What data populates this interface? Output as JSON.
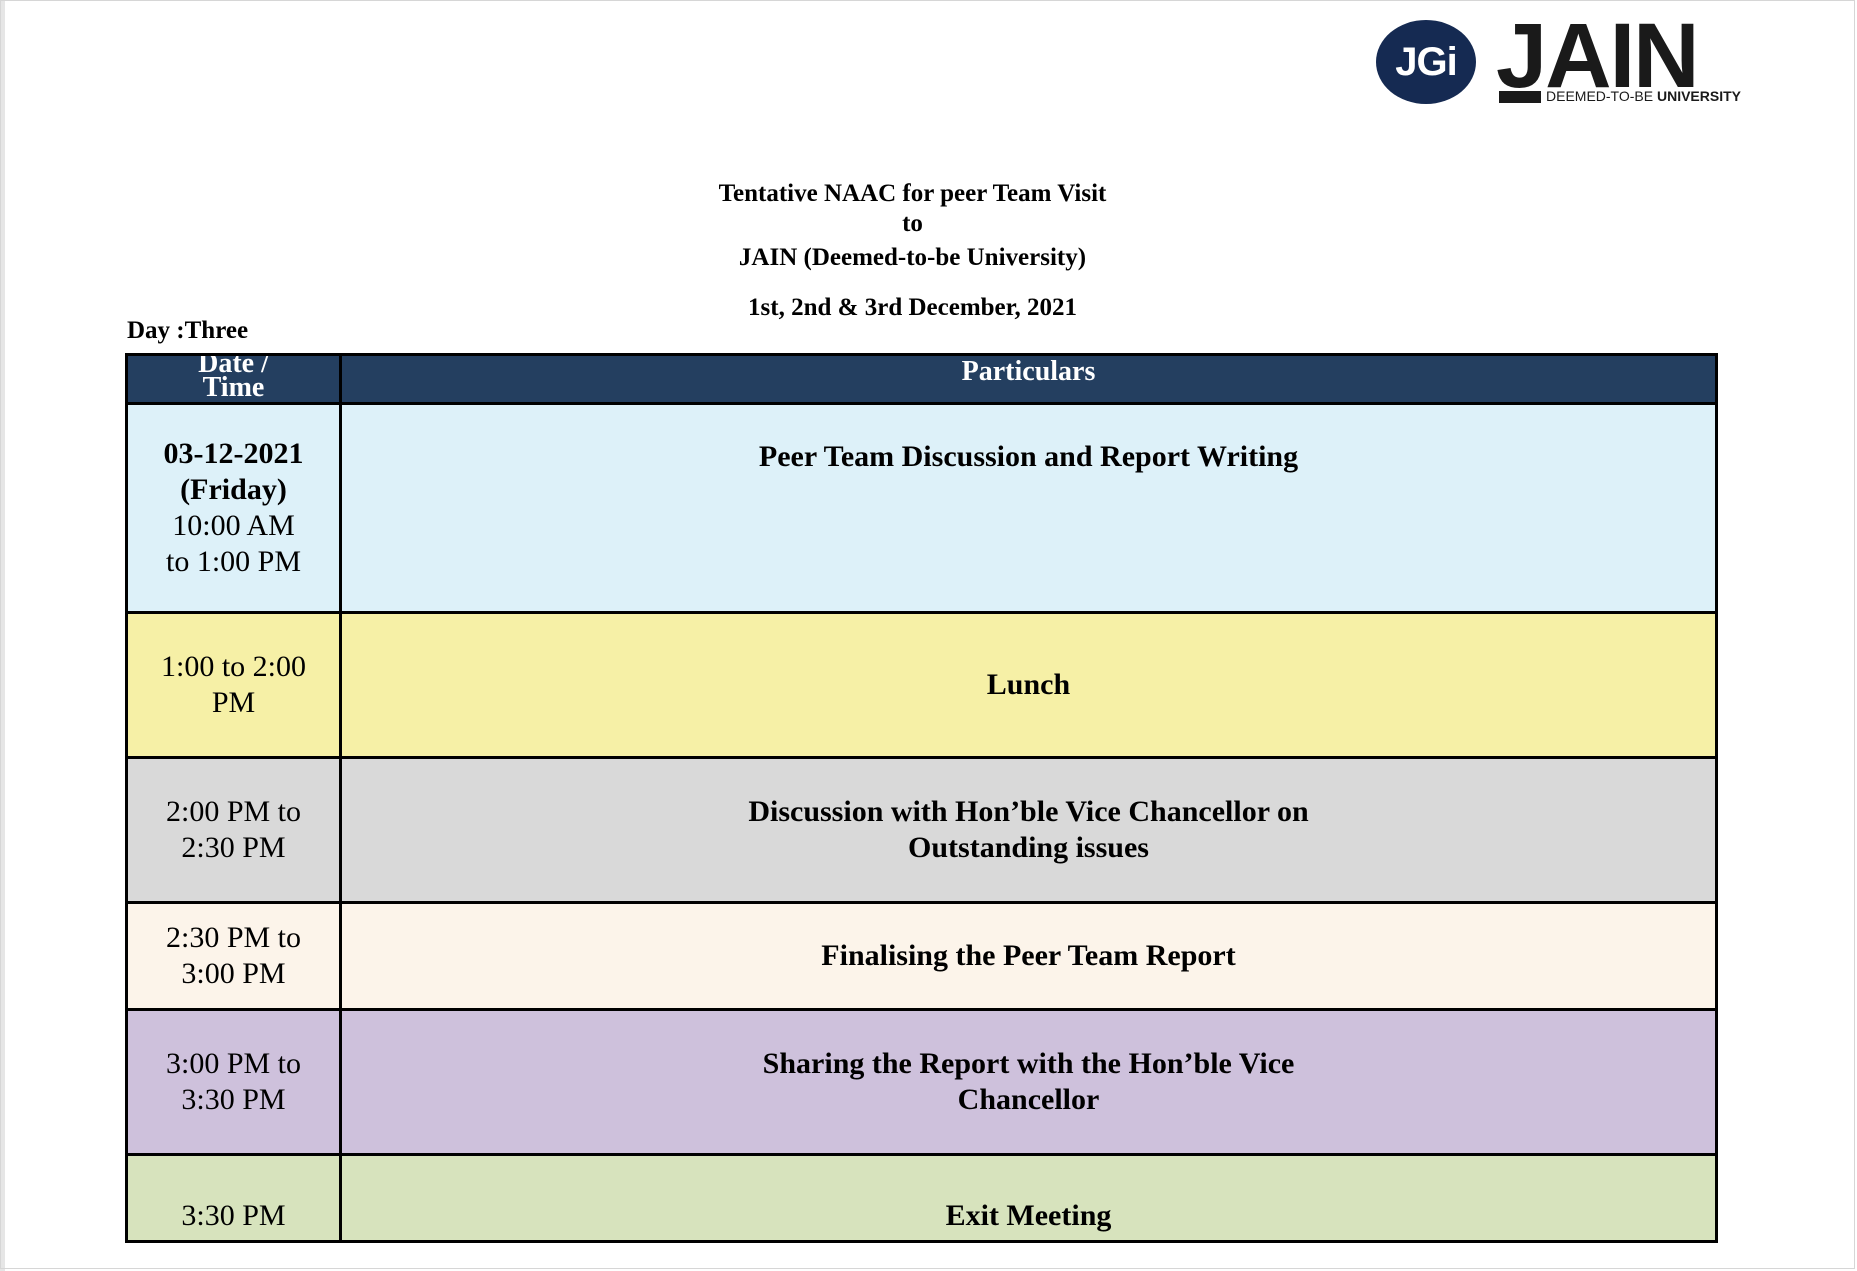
{
  "logo": {
    "badge_text": "JGi",
    "wordmark": "JAIN",
    "sub_plain": "DEEMED-TO-BE ",
    "sub_bold": "UNIVERSITY"
  },
  "heading": {
    "line1": "Tentative NAAC for peer Team Visit",
    "line2": "to",
    "line3": "JAIN (Deemed-to-be University)",
    "dates": "1st, 2nd & 3rd December, 2021"
  },
  "day_label": "Day :Three",
  "table": {
    "header": {
      "col1_line1": "Date /",
      "col1_line2": "Time",
      "col2": "Particulars"
    },
    "rows": [
      {
        "date": "03-12-2021",
        "day": "(Friday)",
        "time_line1": "10:00 AM",
        "time_line2": "to 1:00 PM",
        "activity_line1": "Peer Team Discussion and Report Writing",
        "activity_line2": "",
        "color": "#ddf1f9"
      },
      {
        "time_line1": "1:00 to 2:00",
        "time_line2": "PM",
        "activity_line1": "Lunch",
        "activity_line2": "",
        "color": "#f6f0a6"
      },
      {
        "time_line1": "2:00 PM to",
        "time_line2": "2:30 PM",
        "activity_line1": "Discussion with Hon’ble Vice Chancellor on",
        "activity_line2": "Outstanding issues",
        "color": "#d9d9d9"
      },
      {
        "time_line1": "2:30 PM to",
        "time_line2": "3:00 PM",
        "activity_line1": "Finalising the Peer Team Report",
        "activity_line2": "",
        "color": "#fcf4ea"
      },
      {
        "time_line1": "3:00 PM to",
        "time_line2": "3:30 PM",
        "activity_line1": "Sharing the Report with the Hon’ble Vice",
        "activity_line2": "Chancellor",
        "color": "#cec1dc"
      },
      {
        "time_line1": "3:30 PM",
        "time_line2": "",
        "activity_line1": "Exit Meeting",
        "activity_line2": "",
        "color": "#d7e3bd"
      }
    ]
  },
  "colors": {
    "header_bg": "#243f60",
    "logo_navy": "#152a52"
  }
}
